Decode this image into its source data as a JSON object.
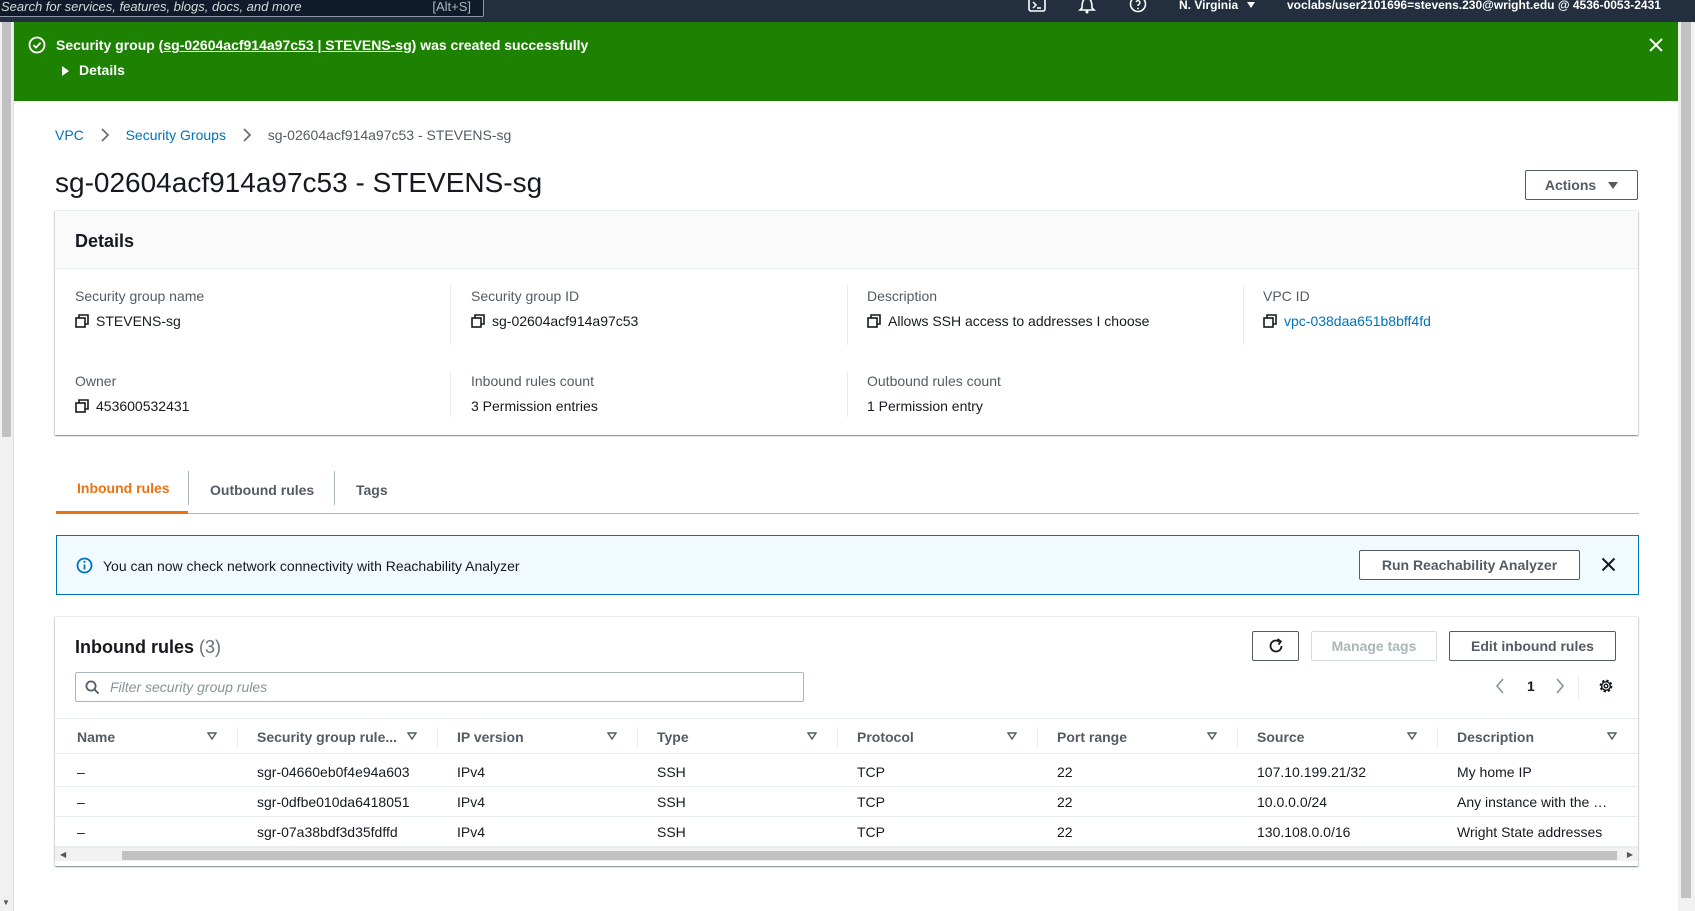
{
  "topnav": {
    "search_placeholder": "Search for services, features, blogs, docs, and more",
    "search_shortcut": "[Alt+S]",
    "region": "N. Virginia",
    "account": "voclabs/user2101696=stevens.230@wright.edu @ 4536-0053-2431"
  },
  "flash": {
    "msg_prefix": "Security group (",
    "msg_link": "sg-02604acf914a97c53 | STEVENS-sg",
    "msg_suffix": ") was created successfully",
    "details_label": "Details",
    "color": "#1d8102"
  },
  "breadcrumb": {
    "items": [
      "VPC",
      "Security Groups"
    ],
    "current": "sg-02604acf914a97c53 - STEVENS-sg"
  },
  "page": {
    "title": "sg-02604acf914a97c53 - STEVENS-sg",
    "actions_label": "Actions"
  },
  "details": {
    "heading": "Details",
    "fields": [
      {
        "label": "Security group name",
        "value": "STEVENS-sg"
      },
      {
        "label": "Security group ID",
        "value": "sg-02604acf914a97c53"
      },
      {
        "label": "Description",
        "value": "Allows SSH access to addresses I choose"
      },
      {
        "label": "VPC ID",
        "value": "vpc-038daa651b8bff4fd"
      },
      {
        "label": "Owner",
        "value": "453600532431"
      },
      {
        "label": "Inbound rules count",
        "value": "3 Permission entries"
      },
      {
        "label": "Outbound rules count",
        "value": "1 Permission entry"
      }
    ]
  },
  "tabs": [
    {
      "label": "Inbound rules"
    },
    {
      "label": "Outbound rules"
    },
    {
      "label": "Tags"
    }
  ],
  "alert": {
    "text": "You can now check network connectivity with Reachability Analyzer",
    "button": "Run Reachability Analyzer"
  },
  "inbound": {
    "title": "Inbound rules",
    "count": "(3)",
    "manage_tags": "Manage tags",
    "edit": "Edit inbound rules",
    "filter_placeholder": "Filter security group rules",
    "page": "1",
    "columns": [
      "Name",
      "Security group rule...",
      "IP version",
      "Type",
      "Protocol",
      "Port range",
      "Source",
      "Description"
    ],
    "rows": [
      [
        "–",
        "sgr-04660eb0f4e94a603",
        "IPv4",
        "SSH",
        "TCP",
        "22",
        "107.10.199.21/32",
        "My home IP"
      ],
      [
        "–",
        "sgr-0dfbe010da6418051",
        "IPv4",
        "SSH",
        "TCP",
        "22",
        "10.0.0.0/24",
        "Any instance with the …"
      ],
      [
        "–",
        "sgr-07a38bdf3d35fdffd",
        "IPv4",
        "SSH",
        "TCP",
        "22",
        "130.108.0.0/16",
        "Wright State addresses"
      ]
    ]
  },
  "colors": {
    "accent": "#ec7211",
    "link": "#0073bb",
    "nav": "#232f3e"
  }
}
